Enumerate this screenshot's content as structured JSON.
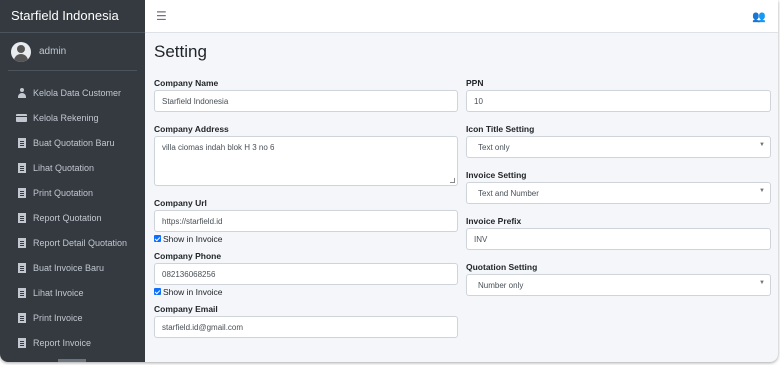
{
  "app": {
    "brand": "Starfield Indonesia"
  },
  "user": {
    "name": "admin"
  },
  "sidebar": {
    "items": [
      {
        "label": "Kelola Data Customer",
        "icon": "user-icon"
      },
      {
        "label": "Kelola Rekening",
        "icon": "credit-card-icon"
      },
      {
        "label": "Buat Quotation Baru",
        "icon": "file-icon"
      },
      {
        "label": "Lihat Quotation",
        "icon": "file-icon"
      },
      {
        "label": "Print Quotation",
        "icon": "file-icon"
      },
      {
        "label": "Report Quotation",
        "icon": "file-icon"
      },
      {
        "label": "Report Detail Quotation",
        "icon": "file-icon"
      },
      {
        "label": "Buat Invoice Baru",
        "icon": "file-icon"
      },
      {
        "label": "Lihat Invoice",
        "icon": "file-icon"
      },
      {
        "label": "Print Invoice",
        "icon": "file-icon"
      },
      {
        "label": "Report Invoice",
        "icon": "file-icon"
      }
    ]
  },
  "topbar": {
    "menu_icon": "☰",
    "users_icon": "👥"
  },
  "page": {
    "title": "Setting"
  },
  "form": {
    "company_name": {
      "label": "Company Name",
      "value": "Starfield Indonesia"
    },
    "company_address": {
      "label": "Company Address",
      "value": "villa ciomas indah blok H 3 no 6"
    },
    "company_url": {
      "label": "Company Url",
      "value": "https://starfield.id",
      "show_label": "Show in Invoice"
    },
    "company_phone": {
      "label": "Company Phone",
      "value": "082136068256",
      "show_label": "Show in Invoice"
    },
    "company_email": {
      "label": "Company Email",
      "value": "starfield.id@gmail.com"
    },
    "ppn": {
      "label": "PPN",
      "value": "10"
    },
    "icon_title_setting": {
      "label": "Icon Title Setting",
      "value": "Text only"
    },
    "invoice_setting": {
      "label": "Invoice Setting",
      "value": "Text and Number"
    },
    "invoice_prefix": {
      "label": "Invoice Prefix",
      "value": "INV"
    },
    "quotation_setting": {
      "label": "Quotation Setting",
      "value": "Number only"
    }
  },
  "colors": {
    "sidebar_bg": "#343a40",
    "content_bg": "#f4f6f9",
    "checkbox": "#0d6efd"
  }
}
